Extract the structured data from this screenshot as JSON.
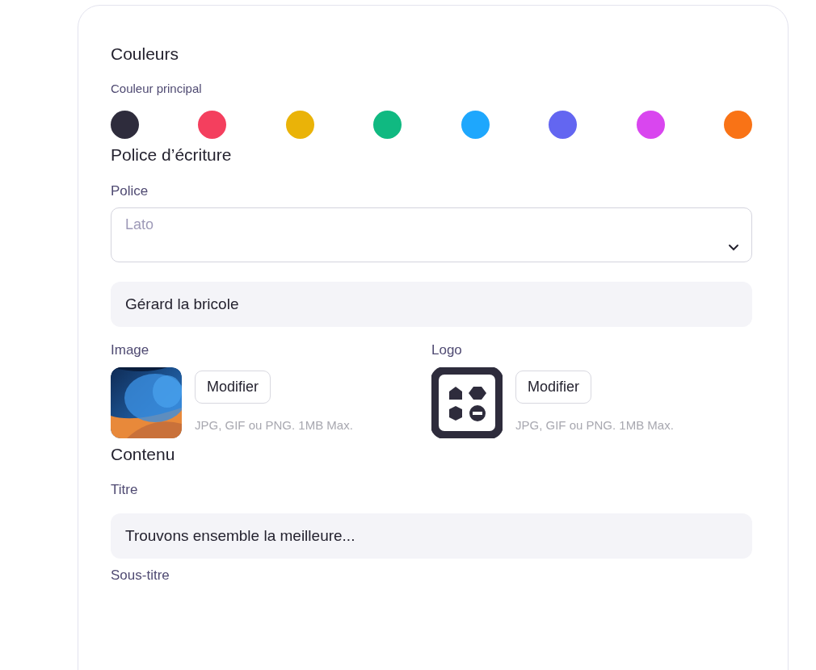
{
  "sections": [
    {
      "title": "Couleurs",
      "label": "Couleur principal",
      "colors": [
        {
          "color": "#2e2c3c"
        },
        {
          "color": "#f43f5e"
        },
        {
          "color": "#eab308"
        },
        {
          "color": "#10b981"
        },
        {
          "color": "#1ea7fd"
        },
        {
          "color": "#6366f1"
        },
        {
          "color": "#d946ef"
        },
        {
          "color": "#f97316"
        }
      ]
    },
    {
      "title": "Police d’écriture",
      "font_label": "Police",
      "font_select": {
        "placeholder": "Lato"
      },
      "name_field": {
        "value": "Gérard la bricole"
      },
      "uploads": [
        {
          "label": "Image",
          "kind": "picture",
          "button": "Modifier",
          "hint": "JPG, GIF ou PNG. 1MB Max."
        },
        {
          "label": "Logo",
          "kind": "logo",
          "button": "Modifier",
          "hint": "JPG, GIF ou PNG. 1MB Max."
        }
      ]
    },
    {
      "title": "Contenu",
      "title_label": "Titre",
      "title_field": {
        "value": "Trouvons ensemble la meilleure..."
      },
      "subtitle_label": "Sous-titre"
    }
  ]
}
